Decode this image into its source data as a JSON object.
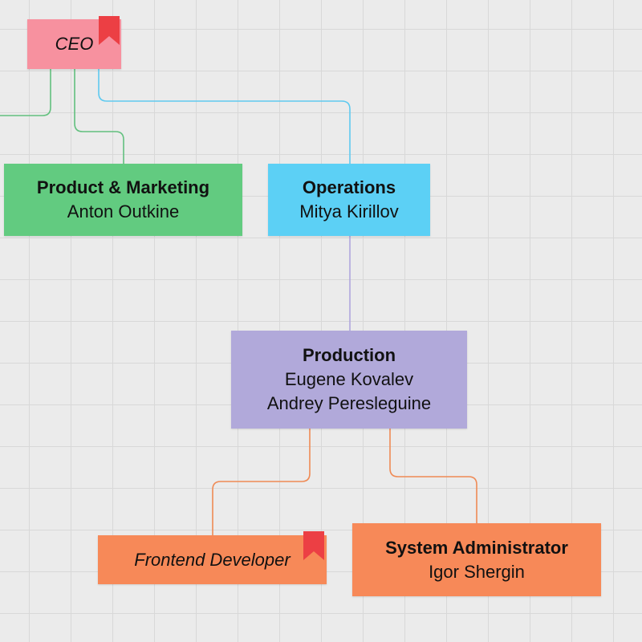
{
  "colors": {
    "ceo": "#f7919f",
    "product_marketing": "#62cb80",
    "operations": "#5cd0f5",
    "production": "#b1a9da",
    "frontend": "#f78958",
    "sysadmin": "#f78958",
    "bookmark": "#ec3f44",
    "line_green": "#62c07e",
    "line_blue": "#5fcaf0",
    "line_purple": "#b1a6dd",
    "line_orange": "#ef8a55"
  },
  "nodes": {
    "ceo": {
      "label": "CEO"
    },
    "product_marketing": {
      "title": "Product & Marketing",
      "people": [
        "Anton Outkine"
      ]
    },
    "operations": {
      "title": "Operations",
      "people": [
        "Mitya Kirillov"
      ]
    },
    "production": {
      "title": "Production",
      "people": [
        "Eugene Kovalev",
        "Andrey Peresleguine"
      ]
    },
    "frontend": {
      "label": "Frontend Developer"
    },
    "sysadmin": {
      "title": "System Administrator",
      "people": [
        "Igor Shergin"
      ]
    }
  },
  "icons": {
    "ceo_marker": "bookmark-icon",
    "frontend_marker": "bookmark-icon"
  }
}
